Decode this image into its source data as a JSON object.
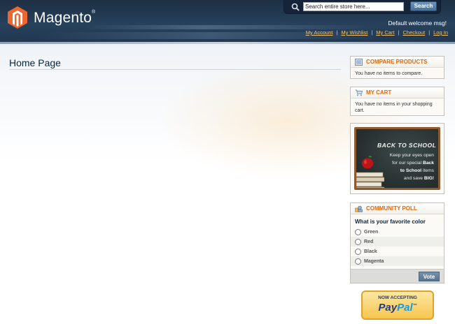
{
  "header": {
    "logo_text": "Magento",
    "logo_reg": "®",
    "search": {
      "placeholder": "Search entire store here...",
      "value": "Search entire store here...",
      "button": "Search"
    },
    "welcome": "Default welcome msg!",
    "links": [
      "My Account",
      "My Wishlist",
      "My Cart",
      "Checkout",
      "Log In"
    ],
    "separator": "|"
  },
  "main": {
    "title": "Home Page"
  },
  "sidebar": {
    "compare": {
      "title": "COMPARE PRODUCTS",
      "text": "You have no items to compare."
    },
    "cart": {
      "title": "MY CART",
      "text": "You have no items in your shopping cart."
    },
    "promo": {
      "title": "BACK TO SCHOOL",
      "line1": "Keep your eyes open",
      "line2_pre": "for our special ",
      "line2_bold": "Back",
      "line3_bold": "to School",
      "line3_post": " items",
      "line4_pre": "and save ",
      "line4_bold": "BIG!"
    },
    "poll": {
      "title": "COMMUNITY POLL",
      "question": "What is your favorite color",
      "options": [
        "Green",
        "Red",
        "Black",
        "Magenta"
      ],
      "vote": "Vote"
    },
    "paypal": {
      "accepting": "NOW ACCEPTING",
      "pay": "Pay",
      "pal": "Pal",
      "tm": "™"
    }
  },
  "colors": {
    "accent": "#e26703",
    "header": "#233a52",
    "link": "#f2c26b"
  },
  "icons": [
    "magento-logo-icon",
    "search-icon",
    "compare-icon",
    "cart-icon",
    "poll-icon"
  ]
}
